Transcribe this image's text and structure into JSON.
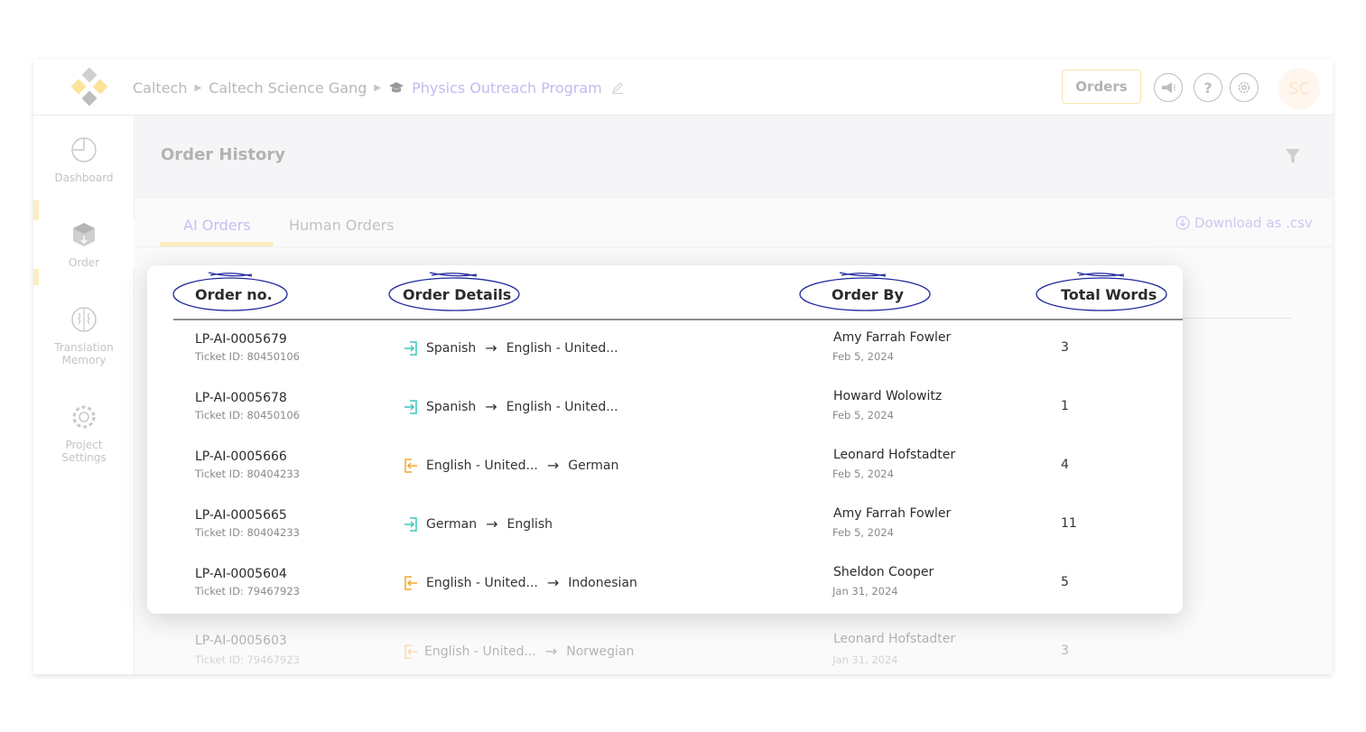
{
  "breadcrumb": {
    "org": "Caltech",
    "team": "Caltech Science Gang",
    "project": "Physics Outreach Program"
  },
  "topbar": {
    "orders_label": "Orders",
    "avatar_initials": "SC"
  },
  "sidebar": {
    "items": [
      {
        "label": "Dashboard",
        "icon": "pie-chart-icon"
      },
      {
        "label": "Order",
        "icon": "box-icon"
      },
      {
        "label": "Translation Memory",
        "icon": "brain-icon"
      },
      {
        "label": "Project Settings",
        "icon": "gear-icon"
      }
    ]
  },
  "main": {
    "title": "Order History",
    "tabs": [
      "AI Orders",
      "Human Orders"
    ],
    "download_label": "Download as .csv"
  },
  "table": {
    "columns": [
      "Order no.",
      "Order Details",
      "Order By",
      "Total Words"
    ],
    "rows": [
      {
        "order_no": "LP-AI-0005679",
        "ticket": "Ticket ID: 80450106",
        "direction": "in",
        "source": "Spanish",
        "target": "English - United...",
        "by": "Amy Farrah Fowler",
        "date": "Feb 5, 2024",
        "words": "3"
      },
      {
        "order_no": "LP-AI-0005678",
        "ticket": "Ticket ID: 80450106",
        "direction": "in",
        "source": "Spanish",
        "target": "English - United...",
        "by": "Howard Wolowitz",
        "date": "Feb 5, 2024",
        "words": "1"
      },
      {
        "order_no": "LP-AI-0005666",
        "ticket": "Ticket ID: 80404233",
        "direction": "out",
        "source": "English - United...",
        "target": "German",
        "by": "Leonard Hofstadter",
        "date": "Feb 5, 2024",
        "words": "4"
      },
      {
        "order_no": "LP-AI-0005665",
        "ticket": "Ticket ID: 80404233",
        "direction": "in",
        "source": "German",
        "target": "English",
        "by": "Amy Farrah Fowler",
        "date": "Feb 5, 2024",
        "words": "11"
      },
      {
        "order_no": "LP-AI-0005604",
        "ticket": "Ticket ID: 79467923",
        "direction": "out",
        "source": "English - United...",
        "target": "Indonesian",
        "by": "Sheldon Cooper",
        "date": "Jan 31, 2024",
        "words": "5"
      }
    ],
    "faded_row": {
      "order_no": "LP-AI-0005603",
      "ticket": "Ticket ID: 79467923",
      "direction": "out",
      "source": "English - United...",
      "target": "Norwegian",
      "by": "Leonard Hofstadter",
      "date": "Jan 31, 2024",
      "words": "3"
    }
  },
  "colors": {
    "accent_purple": "#c6b9ee",
    "accent_yellow": "#fbeec2",
    "annotation_blue": "#1f2a9c",
    "icon_in_teal": "#3cc7b8",
    "icon_out_orange": "#f5a623"
  }
}
